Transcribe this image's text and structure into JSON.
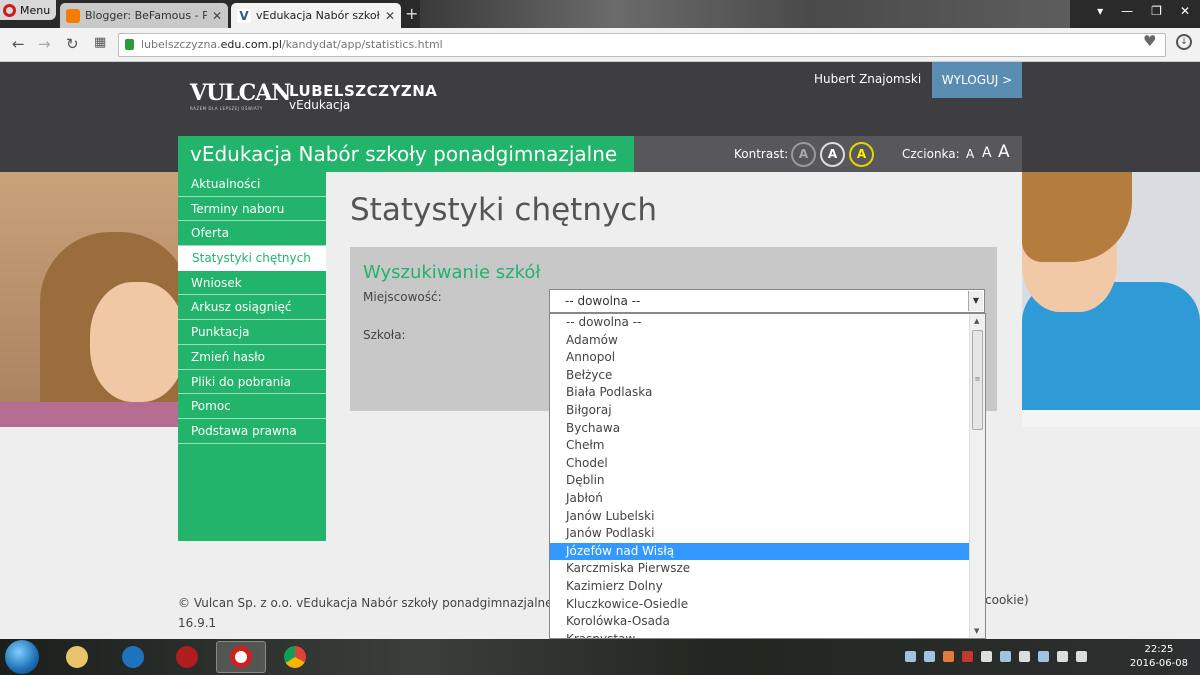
{
  "browser": {
    "menu_label": "Menu",
    "tabs": [
      {
        "title": "Blogger: BeFamous - Przeglą",
        "close": "✕"
      },
      {
        "title": "vEdukacja Nabór szkoły ponadgimnazjalne",
        "close": "✕"
      }
    ],
    "new_tab": "+",
    "window_buttons": [
      "▾",
      "—",
      "❐",
      "✕"
    ],
    "url_prefix": "lubelszczyzna.",
    "url_host": "edu.com.pl",
    "url_path": "/kandydat/app/statistics.html"
  },
  "header": {
    "logo_brand": "VULCAN",
    "logo_tagline": "RAZEM DLA LEPSZEJ OŚWIATY",
    "region_title": "LUBELSZCZYZNA",
    "region_sub": "vEdukacja",
    "user_name": "Hubert Znajomski",
    "logout_label": "WYLOGUJ >",
    "app_title": "vEdukacja Nabór szkoły ponadgimnazjalne",
    "contrast_label": "Kontrast:",
    "contrast_options": [
      "A",
      "A",
      "A"
    ],
    "font_label": "Czcionka:",
    "font_options": [
      "A",
      "A",
      "A"
    ]
  },
  "nav": {
    "items": [
      {
        "label": "Aktualności",
        "active": false
      },
      {
        "label": "Terminy naboru",
        "active": false
      },
      {
        "label": "Oferta",
        "active": false
      },
      {
        "label": "Statystyki chętnych",
        "active": true
      },
      {
        "label": "Wniosek",
        "active": false
      },
      {
        "label": "Arkusz osiągnięć",
        "active": false
      },
      {
        "label": "Punktacja",
        "active": false
      },
      {
        "label": "Zmień hasło",
        "active": false
      },
      {
        "label": "Pliki do pobrania",
        "active": false
      },
      {
        "label": "Pomoc",
        "active": false
      },
      {
        "label": "Podstawa prawna",
        "active": false
      }
    ]
  },
  "main": {
    "page_title": "Statystyki chętnych",
    "search_heading": "Wyszukiwanie szkół",
    "city_label": "Miejscowość:",
    "school_label": "Szkoła:",
    "city_selected": "-- dowolna --"
  },
  "dropdown": {
    "selected_index": 14,
    "options": [
      "-- dowolna --",
      "Adamów",
      "Annopol",
      "Bełżyce",
      "Biała Podlaska",
      "Biłgoraj",
      "Bychawa",
      "Chełm",
      "Chodel",
      "Dęblin",
      "Jabłoń",
      "Janów Lubelski",
      "Janów Podlaski",
      "Józefów nad Wisłą",
      "Karczmiska Pierwsze",
      "Kazimierz Dolny",
      "Kluczkowice-Osiedle",
      "Korolówka-Osada",
      "Krasnystaw"
    ]
  },
  "footer": {
    "copyright": "© Vulcan Sp. z o.o. vEdukacja Nabór szkoły ponadgimnazjalne we",
    "right_fragment": "cookie)",
    "version": "16.9.1"
  },
  "taskbar": {
    "time": "22:25",
    "date": "2016-06-08"
  },
  "colors": {
    "brand_green": "#22b46a",
    "header_dark": "#3d3d42",
    "logout_blue": "#5b8db3",
    "selection_blue": "#3399ff"
  }
}
